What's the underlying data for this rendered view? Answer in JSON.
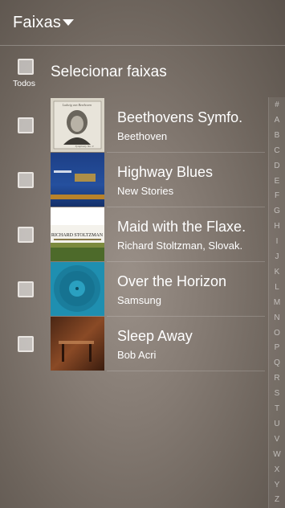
{
  "header": {
    "title": "Faixas",
    "dropdown_icon": "dropdown-arrow-icon"
  },
  "select_all": {
    "todos_label": "Todos",
    "label": "Selecionar faixas"
  },
  "tracks": [
    {
      "title": "Beethovens Symfo.",
      "artist": "Beethoven",
      "album_art_text": "Symphony No. 9"
    },
    {
      "title": "Highway Blues",
      "artist": "New Stories",
      "album_art_text": ""
    },
    {
      "title": "Maid with the Flaxe.",
      "artist": "Richard Stoltzman, Slovak.",
      "album_art_text": "RICHARD STOLTZMAN"
    },
    {
      "title": "Over the Horizon",
      "artist": "Samsung",
      "album_art_text": ""
    },
    {
      "title": "Sleep Away",
      "artist": "Bob Acri",
      "album_art_text": ""
    }
  ],
  "index_letters": [
    "#",
    "A",
    "B",
    "C",
    "D",
    "E",
    "F",
    "G",
    "H",
    "I",
    "J",
    "K",
    "L",
    "M",
    "N",
    "O",
    "P",
    "Q",
    "R",
    "S",
    "T",
    "U",
    "V",
    "W",
    "X",
    "Y",
    "Z"
  ],
  "colors": {
    "checkbox_border": "#e8e4e0",
    "text": "#ffffff"
  }
}
